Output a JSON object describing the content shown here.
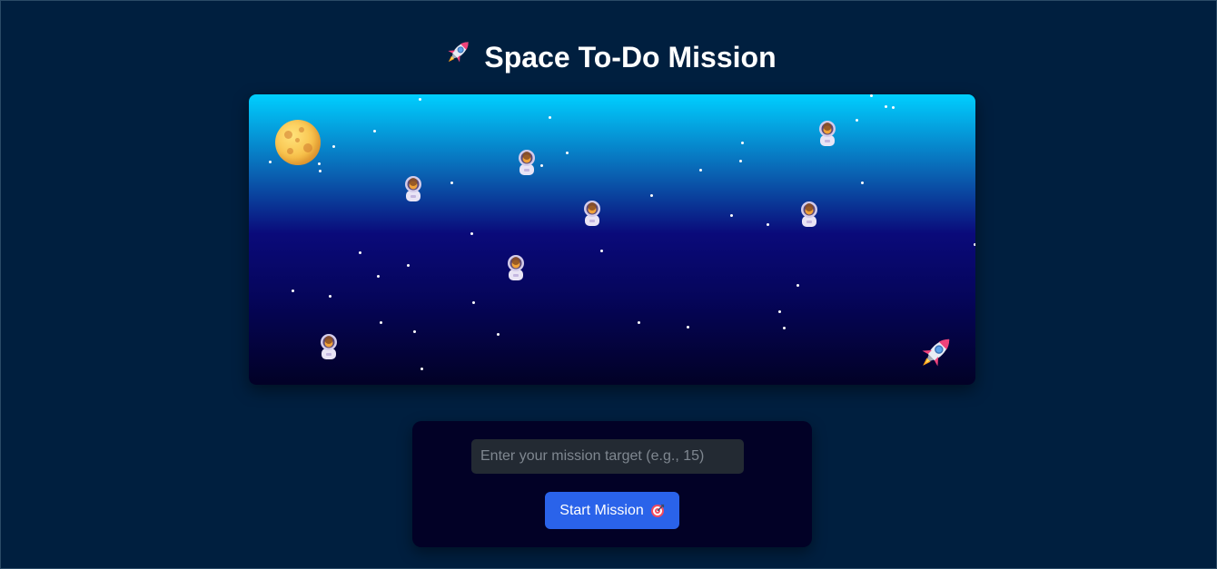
{
  "header": {
    "title": "Space To-Do Mission",
    "icon": "rocket-icon"
  },
  "scene": {
    "moon_icon": "moon-icon",
    "astronaut_icon": "astronaut-icon",
    "rocket_icon": "rocket-icon",
    "astronaut_count": 7
  },
  "mission_form": {
    "input_value": "",
    "input_placeholder": "Enter your mission target (e.g., 15)",
    "start_label": "Start Mission",
    "start_icon": "target-icon"
  },
  "colors": {
    "page_background": "#001f3f",
    "button": "#2a63ea",
    "panel": "#020126"
  }
}
